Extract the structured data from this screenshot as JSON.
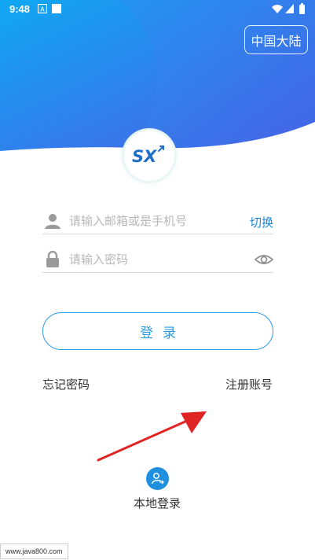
{
  "status_bar": {
    "time": "9:48",
    "icons": [
      "notification-a-icon",
      "square-icon",
      "wifi-icon",
      "signal-icon",
      "battery-icon"
    ]
  },
  "header": {
    "region_label": "中国大陆",
    "logo_text": "SX"
  },
  "form": {
    "account": {
      "placeholder": "请输入邮箱或是手机号",
      "value": "",
      "icon": "user-icon",
      "switch_label": "切换"
    },
    "password": {
      "placeholder": "请输入密码",
      "value": "",
      "icon": "lock-icon",
      "toggle_icon": "eye-icon"
    },
    "login_label": "登录"
  },
  "links": {
    "forgot_password": "忘记密码",
    "register": "注册账号"
  },
  "local_login": {
    "label": "本地登录",
    "icon": "user-switch-icon"
  },
  "watermark": "www.java800.com",
  "colors": {
    "hero_gradient_start": "#1aa3f0",
    "hero_gradient_end": "#4a5fe8",
    "accent": "#2b9be3",
    "arrow": "#e02424"
  }
}
